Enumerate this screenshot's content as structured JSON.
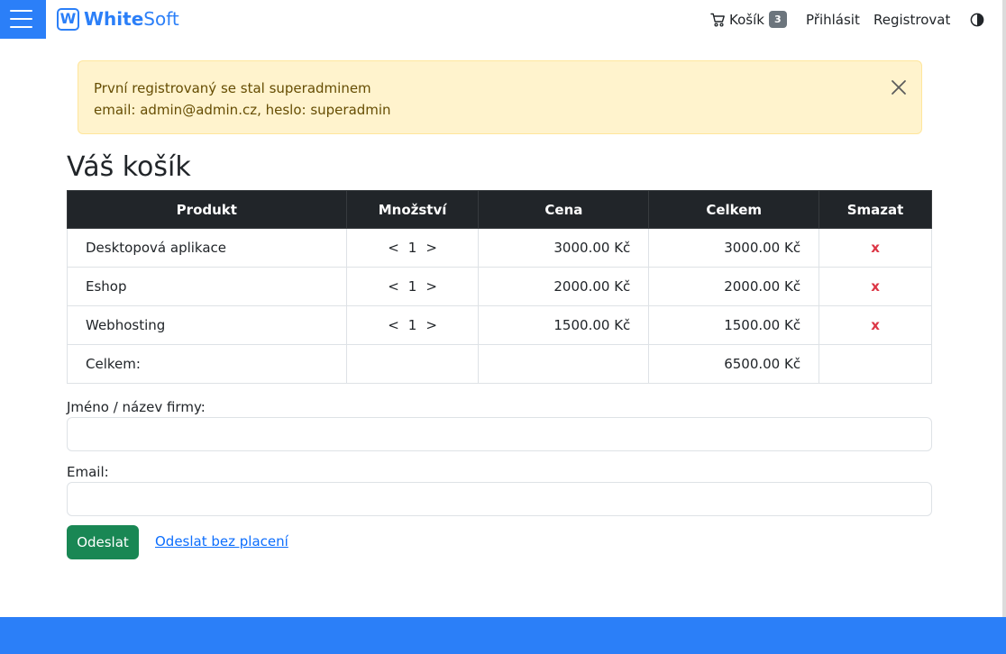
{
  "navbar": {
    "brand_letter": "W",
    "brand_white": "White",
    "brand_soft": "Soft",
    "cart_label": "Košík",
    "cart_count": "3",
    "login_label": "Přihlásit",
    "register_label": "Registrovat",
    "icons": {
      "menu": "hamburger-menu-icon",
      "cart": "cart-icon",
      "theme": "half-circle-theme-icon"
    }
  },
  "alert": {
    "line1": "První registrovaný se stal superadminem",
    "line2": "email: admin@admin.cz, heslo: superadmin"
  },
  "page": {
    "title": "Váš košík"
  },
  "table": {
    "headers": [
      "Produkt",
      "Množství",
      "Cena",
      "Celkem",
      "Smazat"
    ],
    "rows": [
      {
        "product": "Desktopová aplikace",
        "dec": "<",
        "qty": "1",
        "inc": ">",
        "price": "3000.00 Kč",
        "total": "3000.00 Kč",
        "delete": "x"
      },
      {
        "product": "Eshop",
        "dec": "<",
        "qty": "1",
        "inc": ">",
        "price": "2000.00 Kč",
        "total": "2000.00 Kč",
        "delete": "x"
      },
      {
        "product": "Webhosting",
        "dec": "<",
        "qty": "1",
        "inc": ">",
        "price": "1500.00 Kč",
        "total": "1500.00 Kč",
        "delete": "x"
      }
    ],
    "summary": {
      "label": "Celkem:",
      "total": "6500.00 Kč"
    }
  },
  "form": {
    "name_label": "Jméno / název firmy:",
    "name_value": "",
    "email_label": "Email:",
    "email_value": "",
    "submit_label": "Odeslat",
    "free_submit_label": "Odeslat bez placení"
  },
  "colors": {
    "primary": "#2b7ff8",
    "alert_bg": "#fff3cd",
    "alert_text": "#664d03",
    "table_header": "#212529",
    "delete": "#dc3545",
    "success": "#198754",
    "link": "#0d6efd"
  }
}
